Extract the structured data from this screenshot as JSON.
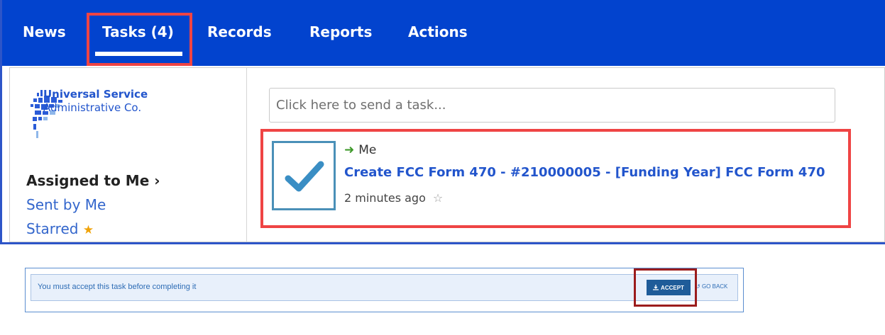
{
  "navbar": {
    "items": [
      {
        "label": "News"
      },
      {
        "label": "Tasks (4)"
      },
      {
        "label": "Records"
      },
      {
        "label": "Reports"
      },
      {
        "label": "Actions"
      }
    ]
  },
  "sidebar": {
    "logo": {
      "line1": "Universal Service",
      "line2": "Administrative Co."
    },
    "items": [
      {
        "label": "Assigned to Me ›"
      },
      {
        "label": "Sent by Me"
      },
      {
        "label": "Starred",
        "icon": "star-icon"
      }
    ]
  },
  "task_input": {
    "placeholder": "Click here to send a task..."
  },
  "task": {
    "from": "Me",
    "title": "Create FCC Form 470 - #210000005 - [Funding Year] FCC Form 470",
    "time": "2 minutes ago"
  },
  "notice": {
    "text": "You must accept this task before completing it",
    "accept_label": "ACCEPT",
    "goback_label": "GO BACK"
  },
  "colors": {
    "navbar": "#0243ce",
    "highlight": "#ef4444",
    "link": "#2255cc",
    "check": "#3a8ec4",
    "accept_button": "#1f5c99"
  }
}
